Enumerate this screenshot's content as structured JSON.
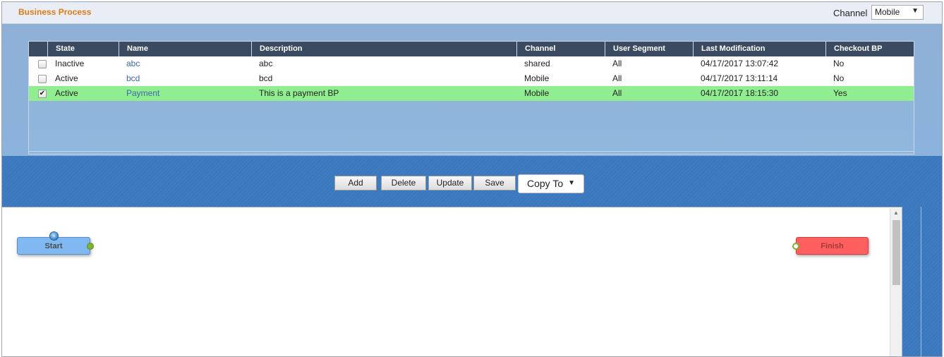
{
  "header": {
    "title": "Business Process",
    "channel_label": "Channel",
    "channel_value": "Mobile"
  },
  "grid": {
    "columns": [
      "State",
      "Name",
      "Description",
      "Channel",
      "User Segment",
      "Last Modification",
      "Checkout BP"
    ],
    "rows": [
      {
        "checked": false,
        "state": "Inactive",
        "name": "abc",
        "description": "abc",
        "channel": "shared",
        "segment": "All",
        "modified": "04/17/2017 13:07:42",
        "checkout": "No"
      },
      {
        "checked": false,
        "state": "Active",
        "name": "bcd",
        "description": "bcd",
        "channel": "Mobile",
        "segment": "All",
        "modified": "04/17/2017 13:11:14",
        "checkout": "No"
      },
      {
        "checked": true,
        "state": "Active",
        "name": "Payment",
        "description": "This is a payment BP",
        "channel": "Mobile",
        "segment": "All",
        "modified": "04/17/2017 18:15:30",
        "checkout": "Yes"
      }
    ],
    "selected_row_color": "#90ee90"
  },
  "toolbar": {
    "add_label": "Add",
    "delete_label": "Delete",
    "update_label": "Update",
    "save_label": "Save",
    "copy_to_label": "Copy To"
  },
  "canvas": {
    "start_label": "Start",
    "finish_label": "Finish",
    "start_icon": "globe-icon"
  },
  "colors": {
    "title": "#e07a16",
    "header_bg": "#3a4a61",
    "start_node": "#80b9f2",
    "finish_node": "#ff5f5f",
    "band": "#3f7cc1"
  }
}
